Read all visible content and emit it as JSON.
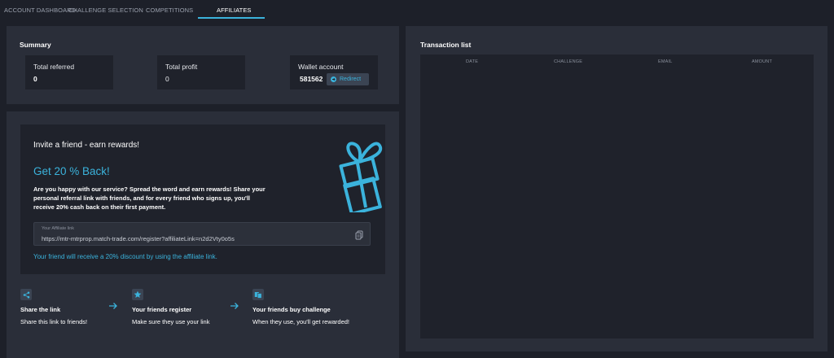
{
  "nav": {
    "tabs": [
      {
        "label": "ACCOUNT DASHBOARD"
      },
      {
        "label": "CHALLENGE SELECTION"
      },
      {
        "label": "COMPETITIONS"
      },
      {
        "label": "AFFILIATES"
      }
    ],
    "active_tab": "AFFILIATES"
  },
  "summary": {
    "title": "Summary",
    "total_referred": {
      "label": "Total referred",
      "value": "0"
    },
    "total_profit": {
      "label": "Total profit",
      "value": "0"
    },
    "wallet": {
      "label": "Wallet account",
      "value": "581562",
      "button_label": "Redirect"
    }
  },
  "invite": {
    "title": "Invite a friend - earn rewards!",
    "headline": "Get 20 % Back!",
    "description": "Are you happy with our service? Spread the word and earn rewards! Share your personal referral link with friends, and for every friend who signs up, you'll receive 20% cash back on their first payment.",
    "link_label": "Your Affiliate link",
    "link_value": "https://mtr-mtrprop.match-trade.com/register?affiliateLink=n2d2Vty0o5s",
    "note": "Your friend will receive a 20% discount by using the affiliate link."
  },
  "steps": [
    {
      "icon": "share-icon",
      "title": "Share the link",
      "desc": "Share this link to friends!"
    },
    {
      "icon": "star-icon",
      "title": "Your friends register",
      "desc": "Make sure they use your link"
    },
    {
      "icon": "cards-icon",
      "title": "Your friends buy challenge",
      "desc": "When they use, you'll get rewarded!"
    }
  ],
  "transactions": {
    "title": "Transaction list",
    "columns": [
      "DATE",
      "CHALLENGE",
      "EMAIL",
      "AMOUNT"
    ],
    "rows": []
  },
  "colors": {
    "accent": "#3bb3dc",
    "background": "#1d2029",
    "panel": "#2a2e39",
    "card": "#1f222b"
  }
}
